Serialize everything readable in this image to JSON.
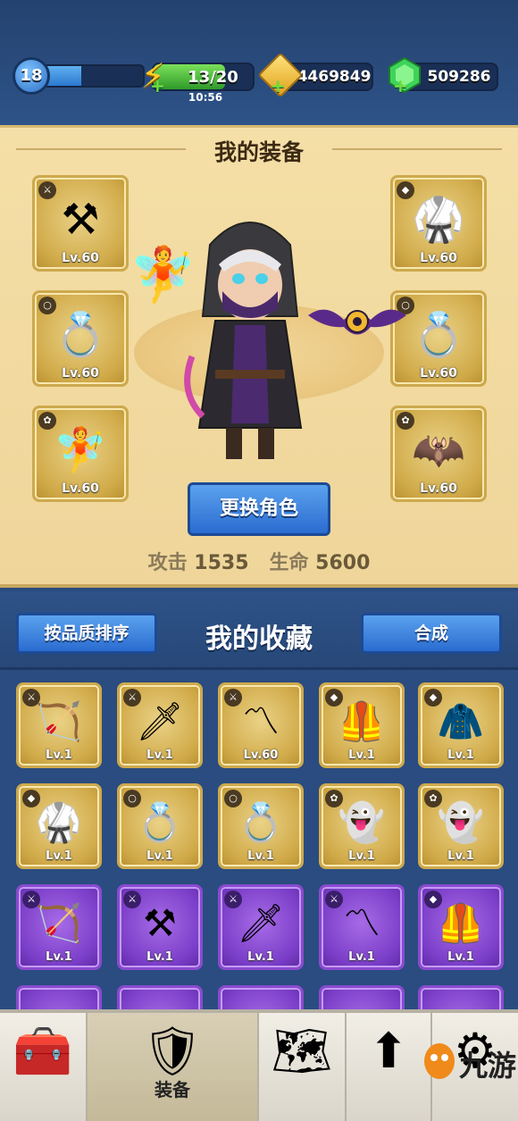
{
  "status": {
    "player_level": "18",
    "level_progress": 0.45,
    "energy": "13/20",
    "energy_timer": "10:56",
    "gold": "4469849",
    "gems": "509286"
  },
  "equip": {
    "title": "我的装备",
    "change_button": "更换角色",
    "attack_label": "攻击",
    "attack_value": "1535",
    "hp_label": "生命",
    "hp_value": "5600",
    "slots_left": [
      {
        "icon": "scythe-icon",
        "type": "weapon",
        "level": "Lv.60"
      },
      {
        "icon": "dragon-ring-icon",
        "type": "ring",
        "level": "Lv.60"
      },
      {
        "icon": "fairy-pet-icon",
        "type": "pet",
        "level": "Lv.60"
      }
    ],
    "slots_right": [
      {
        "icon": "dark-armor-icon",
        "type": "armor",
        "level": "Lv.60"
      },
      {
        "icon": "dragon-ring-icon",
        "type": "ring",
        "level": "Lv.60"
      },
      {
        "icon": "bat-pet-icon",
        "type": "pet",
        "level": "Lv.60"
      }
    ]
  },
  "collection": {
    "sort_button": "按品质排序",
    "title": "我的收藏",
    "merge_button": "合成",
    "rows": [
      [
        {
          "icon": "bow-icon",
          "type": "weapon",
          "level": "Lv.1",
          "quality": "gold"
        },
        {
          "icon": "sword-icon",
          "type": "weapon",
          "level": "Lv.1",
          "quality": "gold"
        },
        {
          "icon": "boomerang-icon",
          "type": "weapon",
          "level": "Lv.60",
          "quality": "gold"
        },
        {
          "icon": "golden-armor-icon",
          "type": "armor",
          "level": "Lv.1",
          "quality": "gold"
        },
        {
          "icon": "red-cape-armor-icon",
          "type": "armor",
          "level": "Lv.1",
          "quality": "gold"
        }
      ],
      [
        {
          "icon": "purple-armor-icon",
          "type": "armor",
          "level": "Lv.1",
          "quality": "gold"
        },
        {
          "icon": "bear-ring-icon",
          "type": "ring",
          "level": "Lv.1",
          "quality": "gold"
        },
        {
          "icon": "wolf-ring-icon",
          "type": "ring",
          "level": "Lv.1",
          "quality": "gold"
        },
        {
          "icon": "reaper-pet-icon",
          "type": "pet",
          "level": "Lv.1",
          "quality": "gold"
        },
        {
          "icon": "ghost-pet-icon",
          "type": "pet",
          "level": "Lv.1",
          "quality": "gold"
        }
      ],
      [
        {
          "icon": "bow-icon",
          "type": "weapon",
          "level": "Lv.1",
          "quality": "purple"
        },
        {
          "icon": "scythe-icon",
          "type": "weapon",
          "level": "Lv.1",
          "quality": "purple"
        },
        {
          "icon": "sword-icon",
          "type": "weapon",
          "level": "Lv.1",
          "quality": "purple"
        },
        {
          "icon": "boomerang-icon",
          "type": "weapon",
          "level": "Lv.1",
          "quality": "purple"
        },
        {
          "icon": "golden-armor-icon",
          "type": "armor",
          "level": "Lv.1",
          "quality": "purple"
        }
      ]
    ]
  },
  "nav": {
    "items": [
      {
        "name": "treasure-chest-icon",
        "label": ""
      },
      {
        "name": "armor-icon",
        "label": "装备"
      },
      {
        "name": "map-icon",
        "label": ""
      },
      {
        "name": "upgrade-icon",
        "label": ""
      },
      {
        "name": "settings-icon",
        "label": ""
      }
    ]
  },
  "watermark": {
    "text": "九游"
  }
}
